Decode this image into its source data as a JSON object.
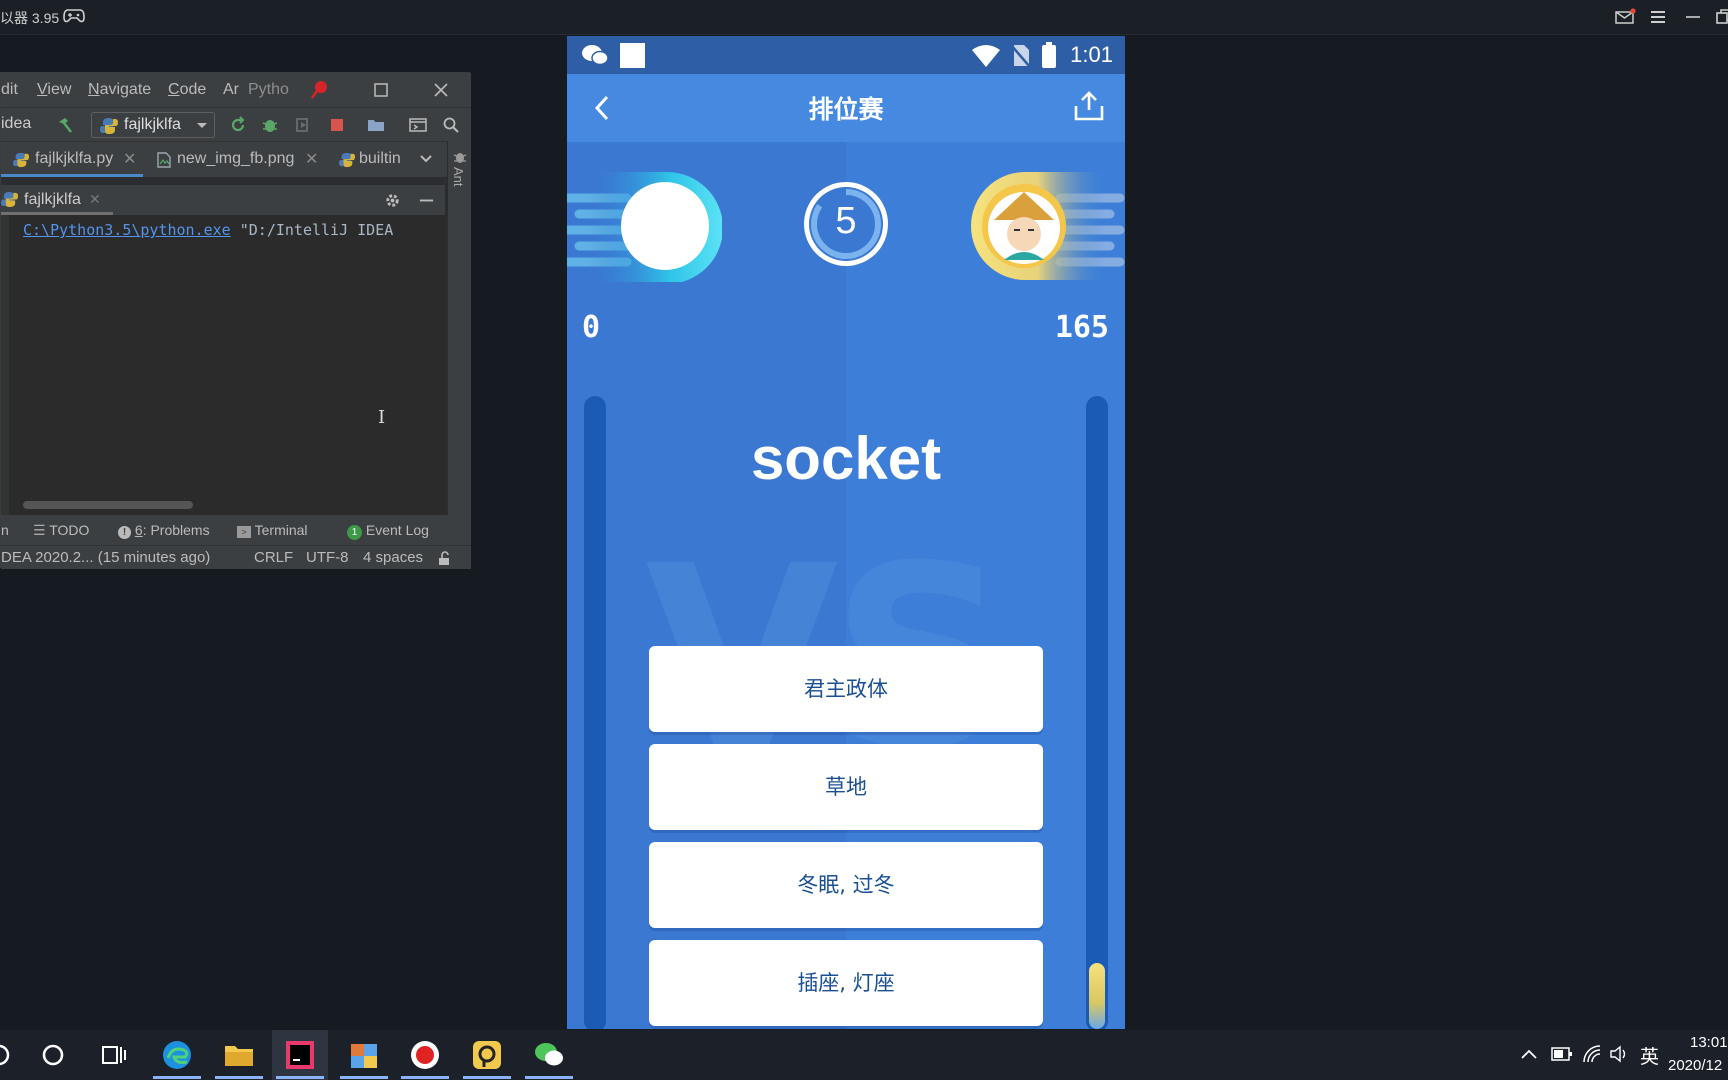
{
  "emulator": {
    "title": "以器 3.95"
  },
  "ide": {
    "menu": {
      "edit": "dit",
      "view_letter": "V",
      "view_rest": "iew",
      "navigate_letter": "N",
      "navigate_rest": "avigate",
      "code_letter": "C",
      "code_rest": "ode",
      "ar": "Ar",
      "window_title": "Pytho"
    },
    "toolbar": {
      "project_crumb": "idea",
      "run_config": "fajlkjklfa"
    },
    "tabs": [
      {
        "label": "fajlkjklfa.py"
      },
      {
        "label": "new_img_fb.png"
      },
      {
        "label": "builtin"
      }
    ],
    "side_strip_label": "Ant",
    "run_panel": {
      "tab_label": "fajlkjklfa",
      "console_link": "C:\\Python3.5\\python.exe",
      "console_rest": " \"D:/IntelliJ IDEA"
    },
    "tool_windows": {
      "run_stub": "n",
      "todo": "TODO",
      "problems_num": "6",
      "problems_label": ": Problems",
      "terminal": "Terminal",
      "event_log_count": "1",
      "event_log": "Event Log"
    },
    "status_bar": {
      "message": "DEA 2020.2... (15 minutes ago)",
      "line_sep": "CRLF",
      "encoding": "UTF-8",
      "indent": "4 spaces"
    }
  },
  "phone": {
    "status_time": "1:01",
    "title": "排位赛",
    "countdown": "5",
    "left_score": "0",
    "right_score": "165",
    "left_progress": 0,
    "right_progress": 0.104,
    "word": "socket",
    "watermark": "VS",
    "options": [
      "君主政体",
      "草地",
      "冬眠, 过冬",
      "插座, 灯座"
    ]
  },
  "taskbar": {
    "lang": "英",
    "time": "13:01",
    "date": "2020/12"
  }
}
